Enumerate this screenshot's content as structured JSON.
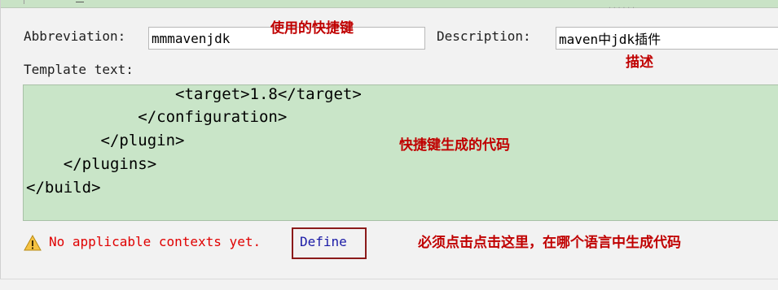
{
  "form": {
    "abbreviation_label": "Abbreviation:",
    "abbreviation_value": "mmmavenjdk",
    "description_label": "Description:",
    "description_value": "maven中jdk插件",
    "template_text_label": "Template text:"
  },
  "template": {
    "lines": [
      "                <target>1.8</target>",
      "            </configuration>",
      "        </plugin>",
      "    </plugins>",
      "</build>"
    ]
  },
  "status": {
    "warning_text": "No applicable contexts yet.",
    "define_link": "Define"
  },
  "annotations": {
    "abbreviation_note": "使用的快捷键",
    "description_note": "描述",
    "template_note": "快捷键生成的代码",
    "define_note": "必须点击点击这里，在哪个语言中生成代码"
  },
  "colors": {
    "editor_background": "#c9e5c8",
    "annotation": "#c00000",
    "warning": "#e00000",
    "link": "#1a1aa6",
    "highlight_box": "#8b1a1a"
  },
  "icons": {
    "warning": "warning-triangle-icon"
  }
}
